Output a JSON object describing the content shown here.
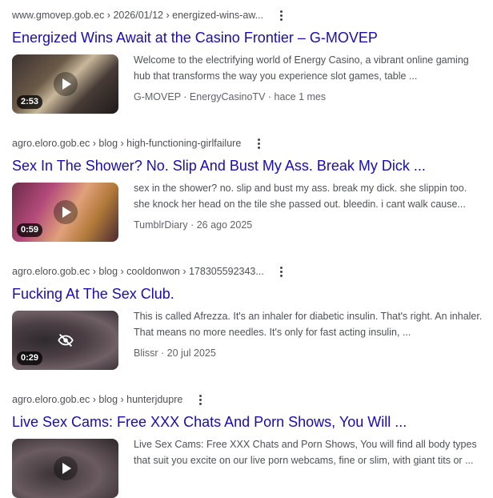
{
  "results": [
    {
      "cite": "www.gmovep.gob.ec › 2026/01/12 › energized-wins-aw...",
      "title": "Energized Wins Await at the Casino Frontier – G-MOVEP",
      "snippet": "Welcome to the electrifying world of Energy Casino, a vibrant online gaming hub that transforms the way you experience slot games, table ...",
      "meta": "G-MOVEP · EnergyCasinoTV · hace 1 mes",
      "duration": "2:53",
      "thumb_icon": "play-icon"
    },
    {
      "cite": "agro.eloro.gob.ec › blog › high-functioning-girlfailure",
      "title": "Sex In The Shower? No. Slip And Bust My Ass. Break My Dick ...",
      "snippet": "sex in the shower? no. slip and bust my ass. break my dick. she slippin too. she knock her head on the tile she passed out. bleedin. i cant walk cause...",
      "meta": "TumblrDiary · 26 ago 2025",
      "duration": "0:59",
      "thumb_icon": "play-icon"
    },
    {
      "cite": "agro.eloro.gob.ec › blog › cooldonwon › 178305592343...",
      "title": "Fucking At The Sex Club.",
      "snippet": "This is called Afrezza. It's an inhaler for diabetic insulin. That's right. An inhaler. That means no more needles. It's only for fast acting insulin, ...",
      "meta": "Blissr · 20 jul 2025",
      "duration": "0:29",
      "thumb_icon": "eye-off-icon"
    },
    {
      "cite": "agro.eloro.gob.ec › blog › hunterjdupre",
      "title": "Live Sex Cams: Free XXX Chats And Porn Shows, You Will ...",
      "snippet": "Live Sex Cams: Free XXX Chats and Porn Shows, You will find all body types that suit you excite on our live porn webcams, fine or slim, with giant tits or ...",
      "meta": "",
      "duration": "",
      "thumb_icon": "play-icon"
    }
  ],
  "colors": {
    "title_link": "#1a0dab",
    "cite": "#4d5156",
    "snippet": "#4d5156"
  }
}
